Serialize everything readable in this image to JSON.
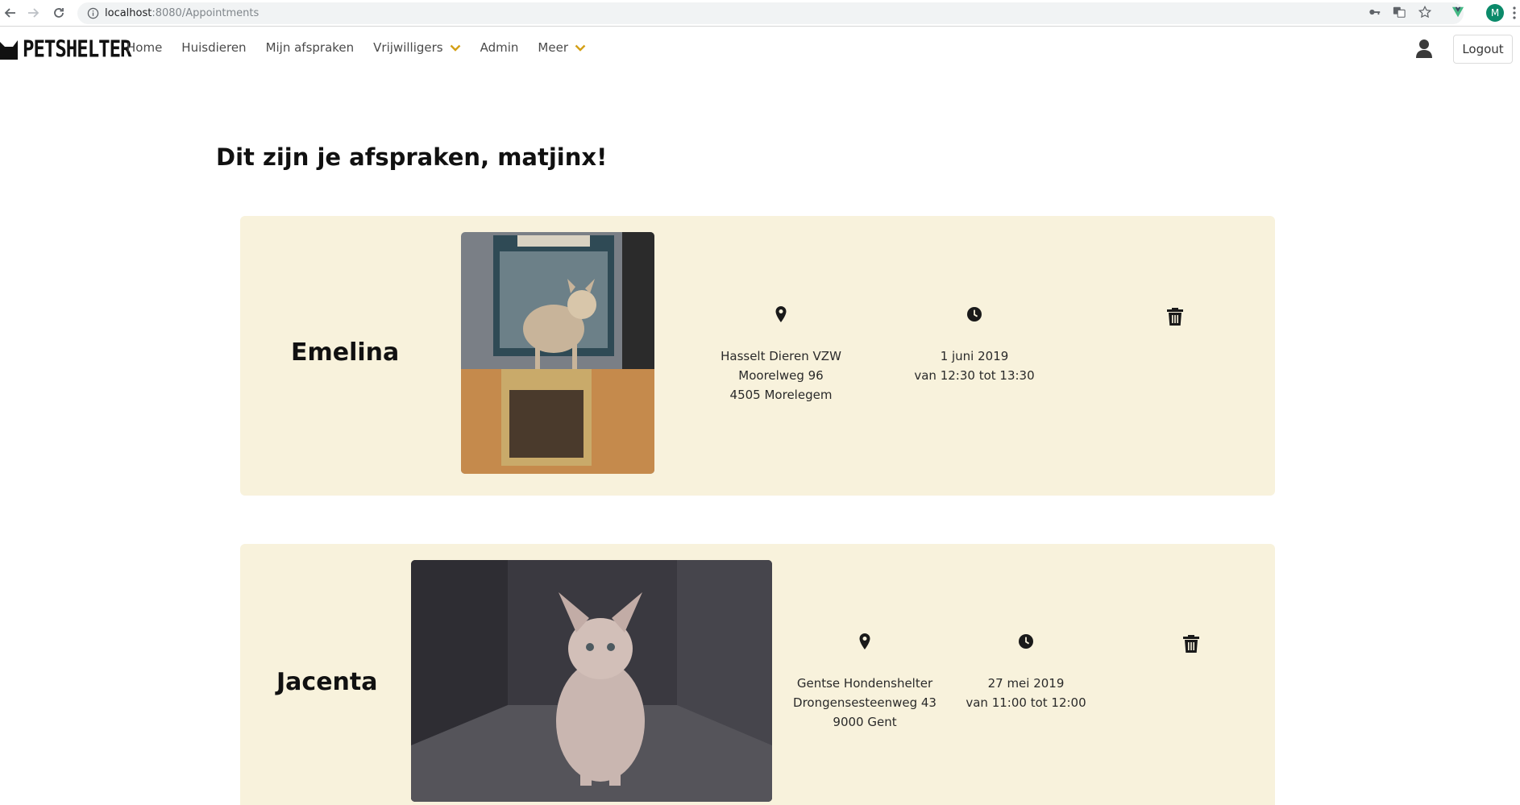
{
  "browser": {
    "url_host": "localhost",
    "url_rest": ":8080/Appointments"
  },
  "navbar": {
    "logo_text": "PETSHELTER",
    "links": [
      {
        "label": "Home"
      },
      {
        "label": "Huisdieren"
      },
      {
        "label": "Mijn afspraken"
      },
      {
        "label": "Vrijwilligers"
      },
      {
        "label": "Admin"
      },
      {
        "label": "Meer"
      }
    ],
    "logout_label": "Logout",
    "profile_initial": "M"
  },
  "page": {
    "title": "Dit zijn je afspraken, matjinx!"
  },
  "appointments": [
    {
      "pet_name": "Emelina",
      "location": [
        "Hasselt Dieren VZW",
        "Moorelweg 96",
        "4505 Morelegem"
      ],
      "date": "1 juni 2019",
      "time": "van 12:30 tot 13:30"
    },
    {
      "pet_name": "Jacenta",
      "location": [
        "Gentse Hondenshelter",
        "Drongensesteenweg 43",
        "9000 Gent"
      ],
      "date": "27 mei 2019",
      "time": "van 11:00 tot 12:00"
    }
  ],
  "colors": {
    "card_bg": "#f8f2dc",
    "chevron": "#d4a017",
    "profile_bg": "#0b8a6a"
  }
}
